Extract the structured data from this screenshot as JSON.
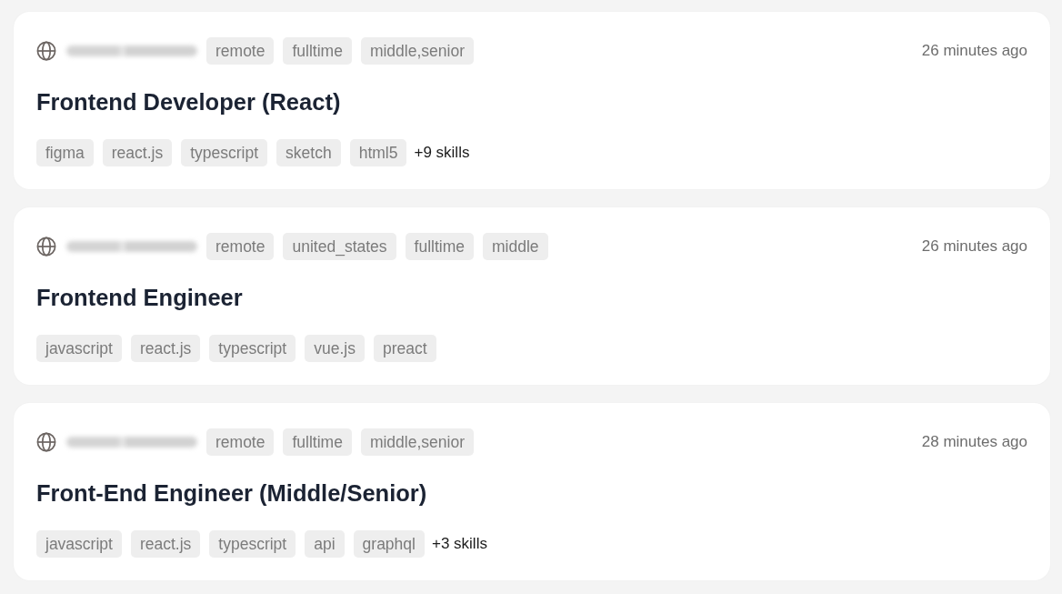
{
  "jobs": [
    {
      "company_blurred": true,
      "tags": [
        "remote",
        "fulltime",
        "middle,senior"
      ],
      "posted": "26 minutes ago",
      "title": "Frontend Developer (React)",
      "skills": [
        "figma",
        "react.js",
        "typescript",
        "sketch",
        "html5"
      ],
      "more_skills": "+9 skills"
    },
    {
      "company_blurred": true,
      "tags": [
        "remote",
        "united_states",
        "fulltime",
        "middle"
      ],
      "posted": "26 minutes ago",
      "title": "Frontend Engineer",
      "skills": [
        "javascript",
        "react.js",
        "typescript",
        "vue.js",
        "preact"
      ]
    },
    {
      "company_blurred": true,
      "tags": [
        "remote",
        "fulltime",
        "middle,senior"
      ],
      "posted": "28 minutes ago",
      "title": "Front-End Engineer (Middle/Senior)",
      "skills": [
        "javascript",
        "react.js",
        "typescript",
        "api",
        "graphql"
      ],
      "more_skills": "+3 skills"
    }
  ]
}
